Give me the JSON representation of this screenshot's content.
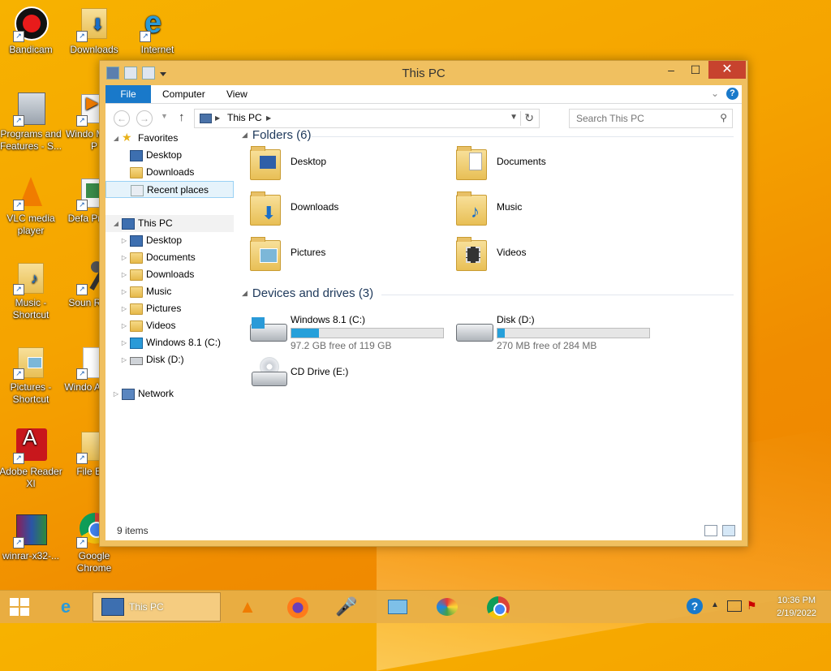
{
  "desktop": {
    "icons": [
      {
        "label": "Bandicam"
      },
      {
        "label": "Downloads"
      },
      {
        "label": "Internet"
      },
      {
        "label": "Programs and Features - S..."
      },
      {
        "label": "Windo Media P"
      },
      {
        "label": "VLC media player"
      },
      {
        "label": "Defa Progra"
      },
      {
        "label": "Music - Shortcut"
      },
      {
        "label": "Soun Recor"
      },
      {
        "label": "Pictures - Shortcut"
      },
      {
        "label": "Windo Anytim"
      },
      {
        "label": "Adobe Reader XI"
      },
      {
        "label": "File Exp"
      },
      {
        "label": "winrar-x32-..."
      },
      {
        "label": "Google Chrome"
      }
    ]
  },
  "window": {
    "title": "This PC",
    "controls": {
      "minimize": "–",
      "maximize": "☐",
      "close": "✕"
    },
    "ribbon": {
      "tabs": [
        "File",
        "Computer",
        "View"
      ]
    },
    "address": {
      "path": "This PC",
      "search_placeholder": "Search This PC"
    },
    "nav": {
      "favorites": {
        "label": "Favorites",
        "items": [
          "Desktop",
          "Downloads",
          "Recent places"
        ]
      },
      "this_pc": {
        "label": "This PC",
        "items": [
          "Desktop",
          "Documents",
          "Downloads",
          "Music",
          "Pictures",
          "Videos",
          "Windows 8.1 (C:)",
          "Disk (D:)"
        ]
      },
      "network": {
        "label": "Network"
      }
    },
    "folders": {
      "header": "Folders (6)",
      "items": [
        "Desktop",
        "Documents",
        "Downloads",
        "Music",
        "Pictures",
        "Videos"
      ]
    },
    "devices": {
      "header": "Devices and drives (3)",
      "items": [
        {
          "name": "Windows 8.1 (C:)",
          "free": "97.2 GB free of 119 GB",
          "used_fraction": 0.18
        },
        {
          "name": "Disk (D:)",
          "free": "270 MB free of 284 MB",
          "used_fraction": 0.05
        },
        {
          "name": "CD Drive (E:)"
        }
      ]
    },
    "status": {
      "count": "9 items"
    }
  },
  "taskbar": {
    "active_window": "This PC",
    "clock": {
      "time": "10:36 PM",
      "date": "2/19/2022"
    },
    "accent": "#1979ca"
  }
}
